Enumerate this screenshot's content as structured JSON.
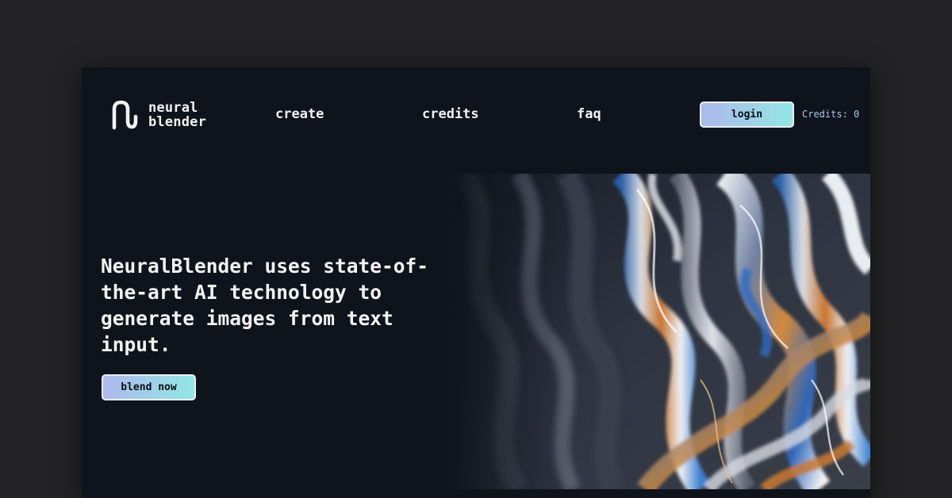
{
  "brand": {
    "line1": "neural",
    "line2": "blender",
    "logo_icon": "blender-squiggle-icon"
  },
  "nav": {
    "create": "create",
    "credits": "credits",
    "faq": "faq"
  },
  "header": {
    "login_label": "login",
    "credits_status": "Credits: 0"
  },
  "hero": {
    "headline": "NeuralBlender uses state-of-the-art AI technology to generate images from text input.",
    "cta_label": "blend now",
    "image_icon": "abstract-iridescent-art-image"
  },
  "colors": {
    "page_background": "#232326",
    "window_background": "#0f131b",
    "text": "#f1f1f1",
    "credits_text": "#a9c9ec",
    "button_gradient_start": "#aeb8ec",
    "button_gradient_end": "#93e6e4"
  }
}
